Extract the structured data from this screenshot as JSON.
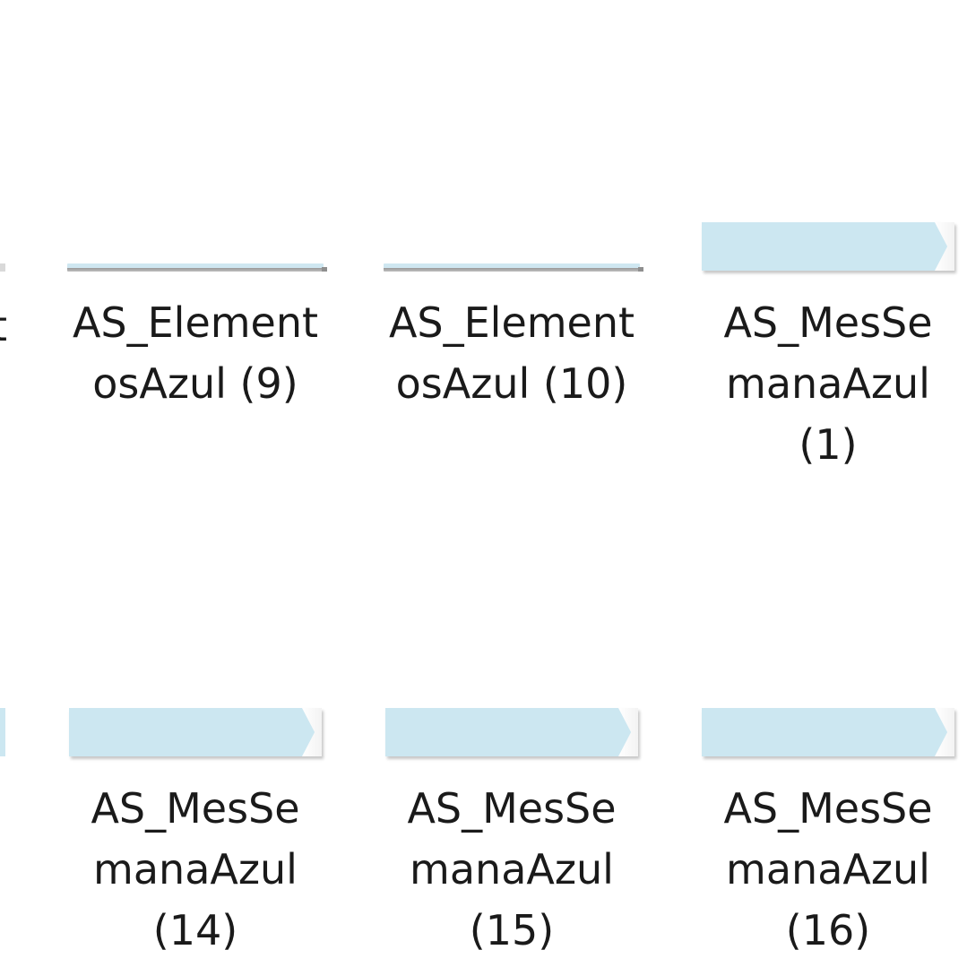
{
  "files": {
    "row1": [
      {
        "label": "AS_Element\nosAzul (9)",
        "thumb": "line"
      },
      {
        "label": "AS_Element\nosAzul (10)",
        "thumb": "line"
      },
      {
        "label": "AS_MesSe\nmanaAzul\n(1)",
        "thumb": "flag"
      }
    ],
    "row2": [
      {
        "label": "AS_MesSe\nmanaAzul\n(14)",
        "thumb": "flag"
      },
      {
        "label": "AS_MesSe\nmanaAzul\n(15)",
        "thumb": "flag"
      },
      {
        "label": "AS_MesSe\nmanaAzul\n(16)",
        "thumb": "flag"
      }
    ],
    "partial_left_label": "t"
  },
  "colors": {
    "thumb_fill": "#cce7f1",
    "text": "#1a1a1a",
    "background": "#ffffff"
  }
}
